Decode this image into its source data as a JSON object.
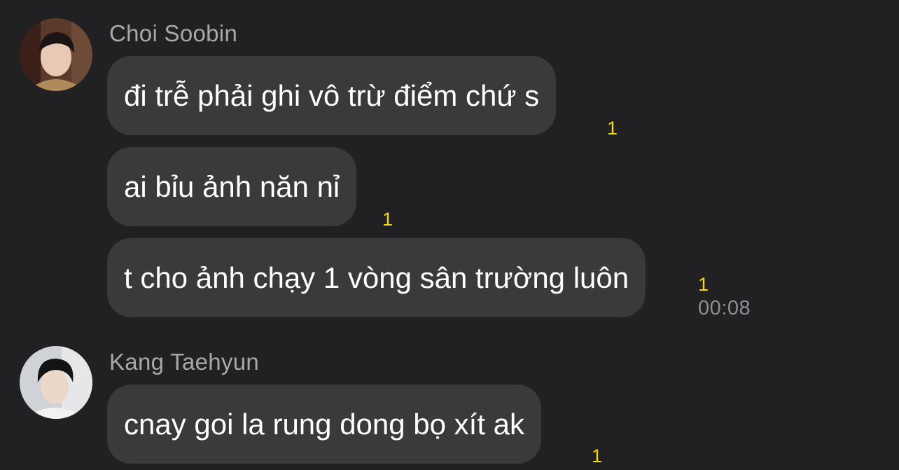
{
  "conversation": {
    "senders": [
      {
        "name": "Choi Soobin",
        "avatar_icon": "user-photo-avatar",
        "messages": [
          {
            "text": "đi trễ phải ghi vô trừ điểm chứ s",
            "unread": "1"
          },
          {
            "text": "ai bỉu ảnh năn nỉ",
            "unread": "1"
          },
          {
            "text": "t cho ảnh chạy 1 vòng sân trường luôn",
            "unread": "1",
            "time": "00:08"
          }
        ]
      },
      {
        "name": "Kang Taehyun",
        "avatar_icon": "user-photo-avatar",
        "messages": [
          {
            "text": "cnay goi la rung dong bọ xít ak",
            "unread": "1"
          }
        ]
      }
    ]
  },
  "colors": {
    "background": "#212123",
    "bubble": "#3a3a3c",
    "unread_indicator": "#f5d90f",
    "name_text": "#a8a8ab",
    "time_text": "#8e8e92"
  }
}
